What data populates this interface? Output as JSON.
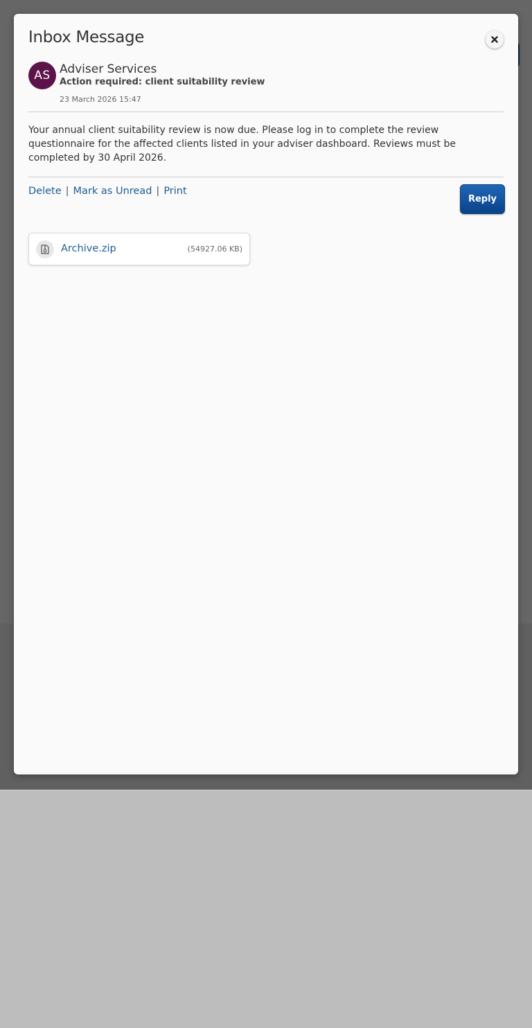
{
  "modal": {
    "title": "Inbox Message",
    "close_icon": "close-icon"
  },
  "message": {
    "avatar_initials": "AS",
    "avatar_color": "#5c1349",
    "sender": "Adviser Services",
    "subject": "Action required: client suitability review",
    "timestamp": "23 March 2026 15:47",
    "body": "Your annual client suitability review is now due. Please log in to complete the review questionnaire for the affected clients listed in your adviser dashboard. Reviews must be completed by 30 April 2026."
  },
  "actions": {
    "delete_label": "Delete",
    "mark_unread_label": "Mark as Unread",
    "print_label": "Print",
    "separator": "|",
    "reply_label": "Reply"
  },
  "attachment": {
    "icon": "zip-file-icon",
    "name": "Archive.zip",
    "size": "(54927.06 KB)"
  },
  "colors": {
    "link": "#1d5c94",
    "reply_button": "#0a4288",
    "overlay": "rgba(0,0,0,0.6)"
  }
}
